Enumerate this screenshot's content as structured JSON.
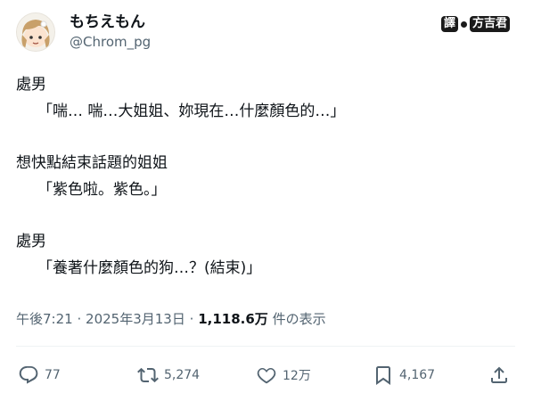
{
  "author": {
    "display_name": "もちえもん",
    "handle": "@Chrom_pg"
  },
  "watermark": {
    "text_a": "譯",
    "text_b": "方吉君"
  },
  "tweet": {
    "lines": [
      "處男",
      "「喘… 喘…大姐姐、妳現在…什麼顏色的…」",
      "想快點結束話題的姐姐",
      "「紫色啦。紫色。」",
      "處男",
      "「養著什麼顏色的狗…？(結束)」"
    ]
  },
  "meta": {
    "time": "午後7:21",
    "separator": "·",
    "date": "2025年3月13日",
    "views_count": "1,118.6万",
    "views_label": "件の表示"
  },
  "actions": {
    "reply_count": "77",
    "retweet_count": "5,274",
    "like_count": "12万",
    "bookmark_count": "4,167"
  },
  "icons": {
    "reply": "reply-icon",
    "retweet": "retweet-icon",
    "like": "heart-icon",
    "bookmark": "bookmark-icon",
    "share": "share-icon"
  },
  "colors": {
    "text_primary": "#0f1419",
    "text_secondary": "#536471",
    "divider": "#eff3f4"
  }
}
